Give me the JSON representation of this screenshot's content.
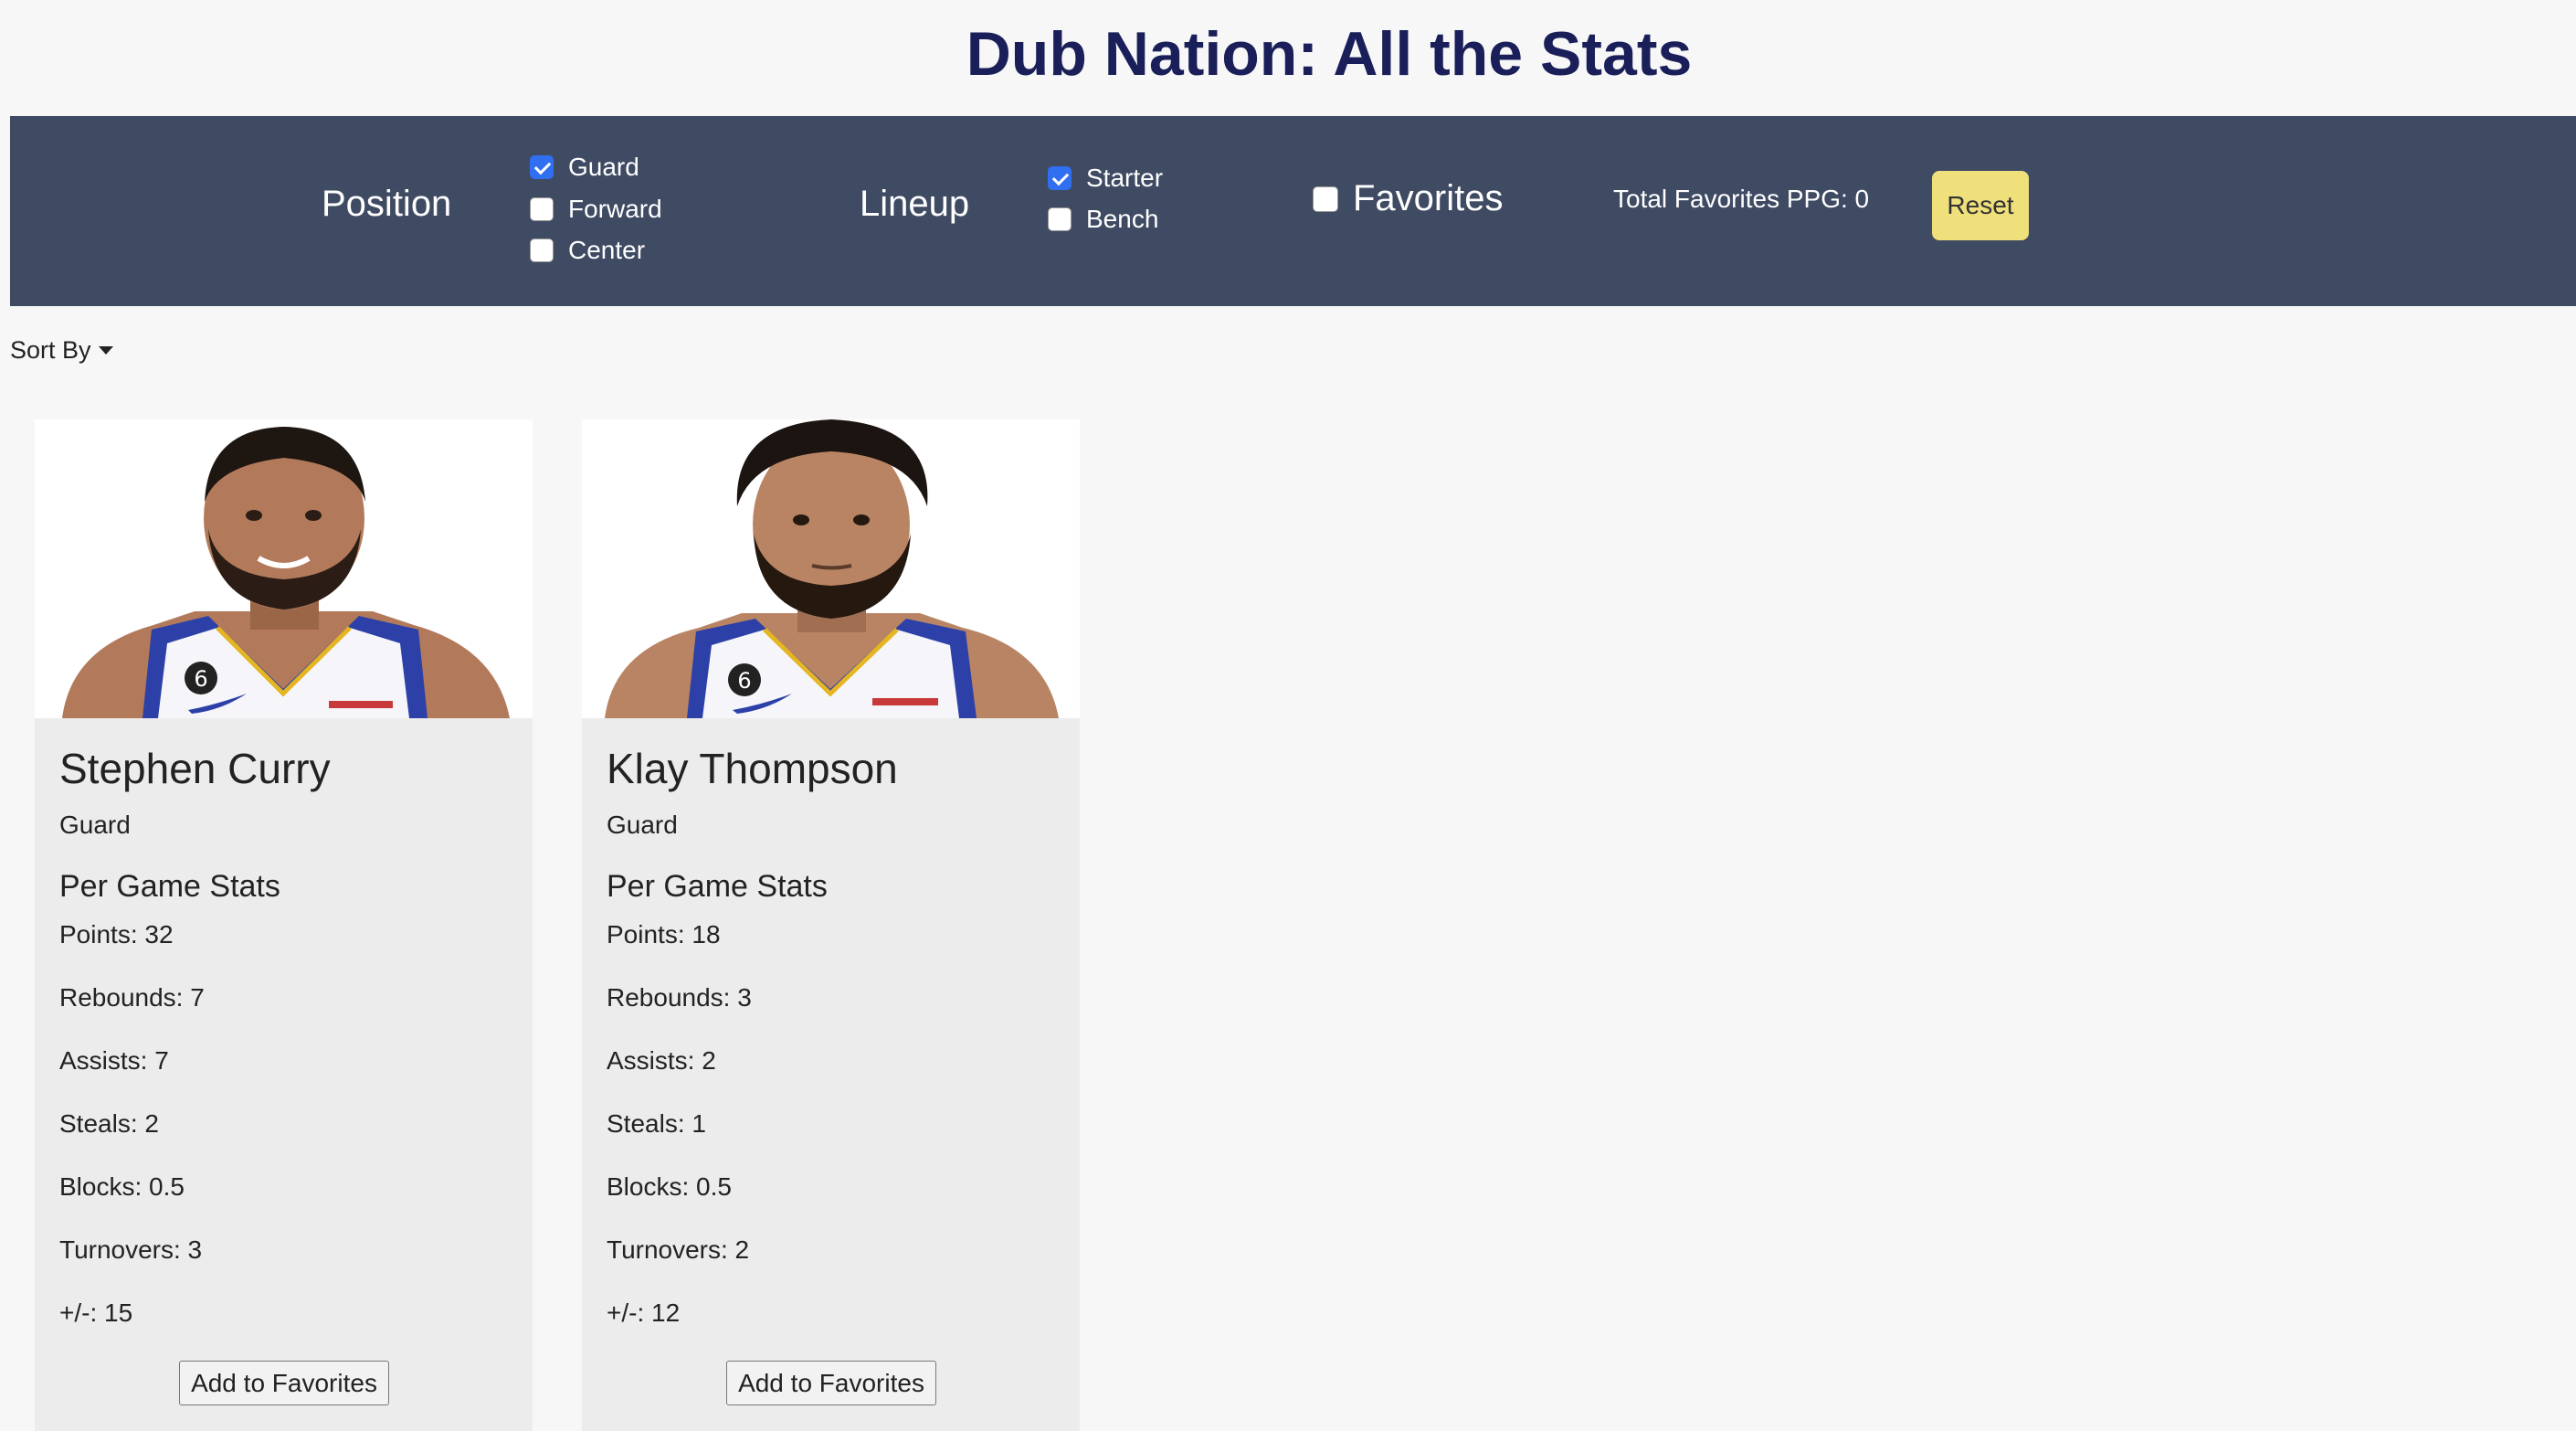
{
  "page_title": "Dub Nation: All the Stats",
  "filters": {
    "position_label": "Position",
    "position_options": [
      {
        "label": "Guard",
        "checked": true
      },
      {
        "label": "Forward",
        "checked": false
      },
      {
        "label": "Center",
        "checked": false
      }
    ],
    "lineup_label": "Lineup",
    "lineup_options": [
      {
        "label": "Starter",
        "checked": true
      },
      {
        "label": "Bench",
        "checked": false
      }
    ],
    "favorites_label": "Favorites",
    "favorites_checked": false,
    "total_favorites_ppg": "Total Favorites PPG: 0",
    "reset_label": "Reset"
  },
  "sort_by_label": "Sort By",
  "stats_heading": "Per Game Stats",
  "favorite_button_label": "Add to Favorites",
  "players": [
    {
      "name": "Stephen Curry",
      "position": "Guard",
      "stats": {
        "points": "Points: 32",
        "rebounds": "Rebounds: 7",
        "assists": "Assists: 7",
        "steals": "Steals: 2",
        "blocks": "Blocks: 0.5",
        "turnovers": "Turnovers: 3",
        "plus_minus": "+/-: 15"
      }
    },
    {
      "name": "Klay Thompson",
      "position": "Guard",
      "stats": {
        "points": "Points: 18",
        "rebounds": "Rebounds: 3",
        "assists": "Assists: 2",
        "steals": "Steals: 1",
        "blocks": "Blocks: 0.5",
        "turnovers": "Turnovers: 2",
        "plus_minus": "+/-: 12"
      }
    }
  ],
  "colors": {
    "header_bar": "#3f4a63",
    "title_text": "#1a1f5a",
    "reset_button": "#efe07b",
    "checkbox_checked": "#2f6ff0",
    "jersey_blue": "#2c40a8",
    "jersey_gold": "#e5b522"
  }
}
